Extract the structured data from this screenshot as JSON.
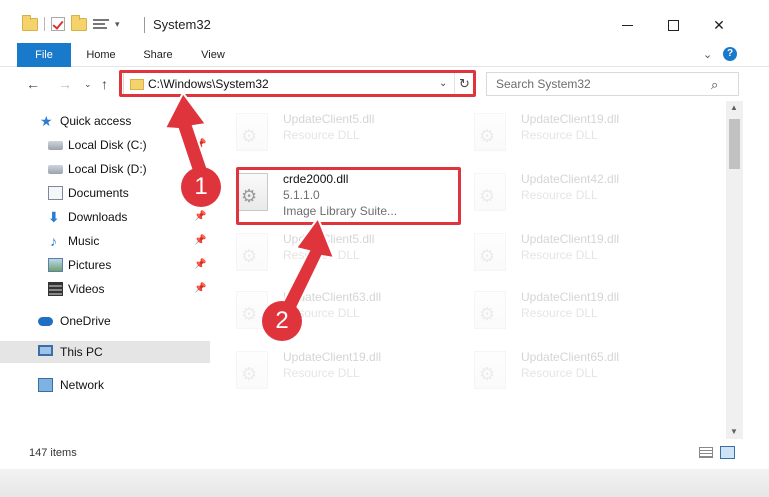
{
  "window": {
    "title": "System32",
    "minimize_icon": "minimize-icon",
    "maximize_icon": "maximize-icon",
    "close_glyph": "✕"
  },
  "ribbon": {
    "tabs": [
      "File",
      "Home",
      "Share",
      "View"
    ],
    "expand_glyph": "⌄",
    "help_glyph": "?"
  },
  "nav": {
    "back_glyph": "←",
    "forward_glyph": "→",
    "recent_glyph": "⌄",
    "up_glyph": "↑",
    "address": "C:\\Windows\\System32",
    "address_dropdown_glyph": "⌄",
    "refresh_glyph": "↻",
    "search_placeholder": "Search System32",
    "search_glyph": "⌕"
  },
  "sidebar": {
    "items": [
      {
        "label": "Quick access",
        "icon": "star-icon"
      },
      {
        "label": "Local Disk (C:)",
        "icon": "disk-icon",
        "pinned": true
      },
      {
        "label": "Local Disk (D:)",
        "icon": "disk-icon",
        "pinned": true
      },
      {
        "label": "Documents",
        "icon": "documents-icon",
        "pinned": true
      },
      {
        "label": "Downloads",
        "icon": "downloads-icon",
        "pinned": true
      },
      {
        "label": "Music",
        "icon": "music-icon",
        "pinned": true
      },
      {
        "label": "Pictures",
        "icon": "pictures-icon",
        "pinned": true
      },
      {
        "label": "Videos",
        "icon": "videos-icon",
        "pinned": true
      },
      {
        "label": "OneDrive",
        "icon": "onedrive-icon"
      },
      {
        "label": "This PC",
        "icon": "this-pc-icon",
        "selected": true
      },
      {
        "label": "Network",
        "icon": "network-icon"
      }
    ],
    "pin_glyph": "📌",
    "star_glyph": "★",
    "download_glyph": "⬇",
    "music_glyph": "♪"
  },
  "files": {
    "left": [
      {
        "name": "UpdateClient5.dll",
        "type": "Resource DLL",
        "faded": true
      },
      {
        "name": "crde2000.dll",
        "version": "5.1.1.0",
        "description": "Image Library Suite...",
        "faded": false
      },
      {
        "name": "UpdateClient5.dll",
        "type": "Resource DLL",
        "faded": true
      },
      {
        "name": "UpdateClient63.dll",
        "type": "Resource DLL",
        "faded": true
      },
      {
        "name": "UpdateClient19.dll",
        "type": "Resource DLL",
        "faded": true
      }
    ],
    "right": [
      {
        "name": "UpdateClient19.dll",
        "type": "Resource DLL"
      },
      {
        "name": "UpdateClient42.dll",
        "type": "Resource DLL"
      },
      {
        "name": "UpdateClient19.dll",
        "type": "Resource DLL"
      },
      {
        "name": "UpdateClient19.dll",
        "type": "Resource DLL"
      },
      {
        "name": "UpdateClient65.dll",
        "type": "Resource DLL"
      }
    ]
  },
  "scrollbar": {
    "up_glyph": "▲",
    "down_glyph": "▼"
  },
  "status": {
    "item_count": "147 items"
  },
  "annotations": {
    "step1": "1",
    "step2": "2",
    "color": "#e0343d"
  }
}
